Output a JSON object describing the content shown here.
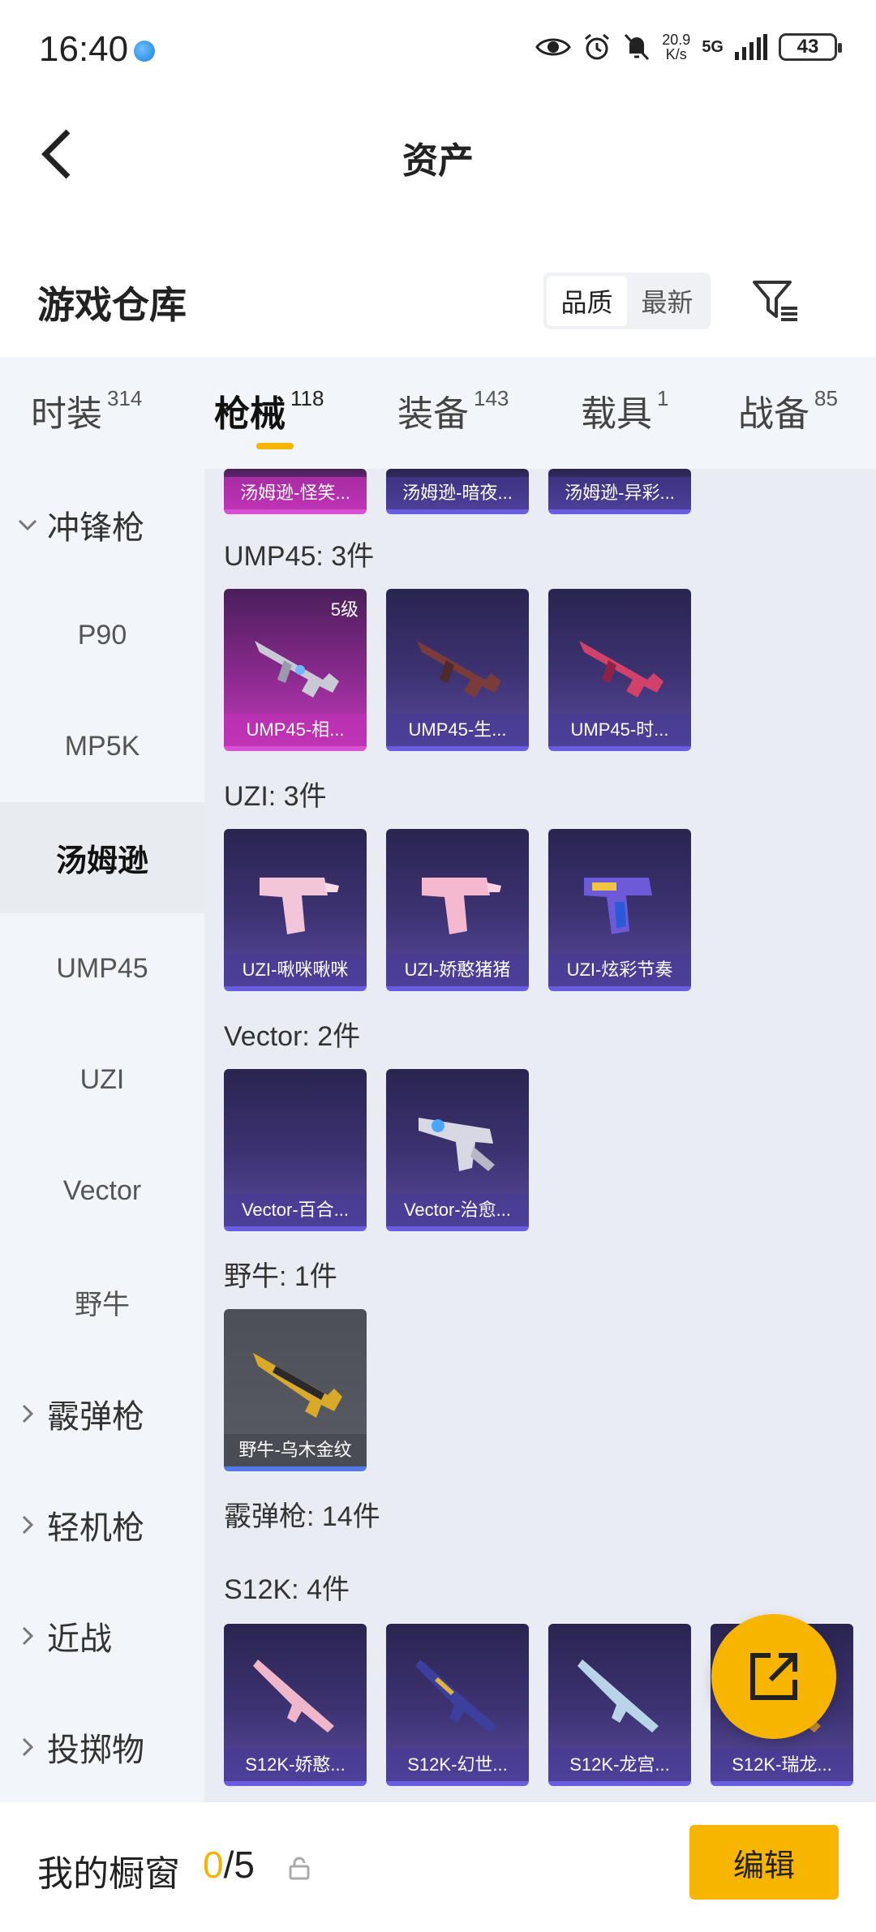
{
  "status": {
    "time": "16:40",
    "net_speed_value": "20.9",
    "net_speed_unit": "K/s",
    "network": "5G",
    "battery": "43"
  },
  "header": {
    "title": "资产"
  },
  "warehouse": {
    "title": "游戏仓库",
    "sort_options": [
      "品质",
      "最新"
    ],
    "sort_selected": "品质"
  },
  "tabs": [
    {
      "label": "时装",
      "count": "314"
    },
    {
      "label": "枪械",
      "count": "118"
    },
    {
      "label": "装备",
      "count": "143"
    },
    {
      "label": "载具",
      "count": "1"
    },
    {
      "label": "战备",
      "count": "85"
    }
  ],
  "sidebar": [
    {
      "label": "冲锋枪",
      "type": "group",
      "expanded": true
    },
    {
      "label": "P90",
      "type": "sub"
    },
    {
      "label": "MP5K",
      "type": "sub"
    },
    {
      "label": "汤姆逊",
      "type": "sub",
      "active": true
    },
    {
      "label": "UMP45",
      "type": "sub"
    },
    {
      "label": "UZI",
      "type": "sub"
    },
    {
      "label": "Vector",
      "type": "sub"
    },
    {
      "label": "野牛",
      "type": "sub"
    },
    {
      "label": "霰弹枪",
      "type": "group"
    },
    {
      "label": "轻机枪",
      "type": "group"
    },
    {
      "label": "近战",
      "type": "group"
    },
    {
      "label": "投掷物",
      "type": "group"
    }
  ],
  "content": {
    "top_partial_items": [
      "汤姆逊-怪笑...",
      "汤姆逊-暗夜...",
      "汤姆逊-异彩..."
    ],
    "sections": [
      {
        "title": "UMP45: 3件",
        "items": [
          {
            "name": "UMP45-相...",
            "level": "5级",
            "rarity": "pink"
          },
          {
            "name": "UMP45-生...",
            "rarity": "purple"
          },
          {
            "name": "UMP45-时...",
            "rarity": "purple"
          }
        ]
      },
      {
        "title": "UZI: 3件",
        "items": [
          {
            "name": "UZI-啾咪啾咪",
            "rarity": "purple"
          },
          {
            "name": "UZI-娇憨猪猪",
            "rarity": "purple"
          },
          {
            "name": "UZI-炫彩节奏",
            "rarity": "purple"
          }
        ]
      },
      {
        "title": "Vector: 2件",
        "items": [
          {
            "name": "Vector-百合...",
            "rarity": "purple"
          },
          {
            "name": "Vector-治愈...",
            "rarity": "purple"
          }
        ]
      },
      {
        "title": "野牛: 1件",
        "items": [
          {
            "name": "野牛-乌木金纹",
            "rarity": "grey"
          }
        ]
      }
    ],
    "group_title": "霰弹枪: 14件",
    "s12k_title": "S12K: 4件",
    "s12k_items": [
      {
        "name": "S12K-娇憨...",
        "rarity": "purple"
      },
      {
        "name": "S12K-幻世...",
        "rarity": "purple"
      },
      {
        "name": "S12K-龙宫...",
        "rarity": "purple"
      },
      {
        "name": "S12K-瑞龙...",
        "rarity": "purple"
      }
    ]
  },
  "bottom": {
    "label": "我的橱窗",
    "used": "0",
    "total": "/5",
    "edit_label": "编辑"
  },
  "colors": {
    "accent": "#f5b400",
    "pink_rarity": "#c43ab8",
    "purple_rarity": "#5a4a9c"
  }
}
